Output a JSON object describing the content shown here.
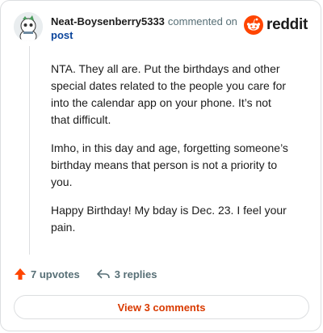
{
  "comment": {
    "username": "Neat-Boysenberry5333",
    "meta_text": "commented on",
    "post_link": "post",
    "paragraphs": [
      "NTA. They all are. Put the birthdays and other special dates related to the people you care for into the calendar app on your phone. It’s not that difficult.",
      "Imho, in this day and age, forgetting someone’s birthday means that person is not a priority to you.",
      "Happy Birthday! My bday is Dec. 23. I feel your pain."
    ]
  },
  "brand": {
    "wordmark": "reddit",
    "color": "#ff4500"
  },
  "actions": {
    "upvotes": "7 upvotes",
    "replies": "3 replies"
  },
  "view_comments_label": "View 3 comments",
  "colors": {
    "accent": "#ff4500",
    "link": "#0a449b",
    "button_text": "#d93a00"
  },
  "icons": [
    "avatar",
    "reddit-logo-icon",
    "upvote-arrow-icon",
    "reply-icon"
  ]
}
